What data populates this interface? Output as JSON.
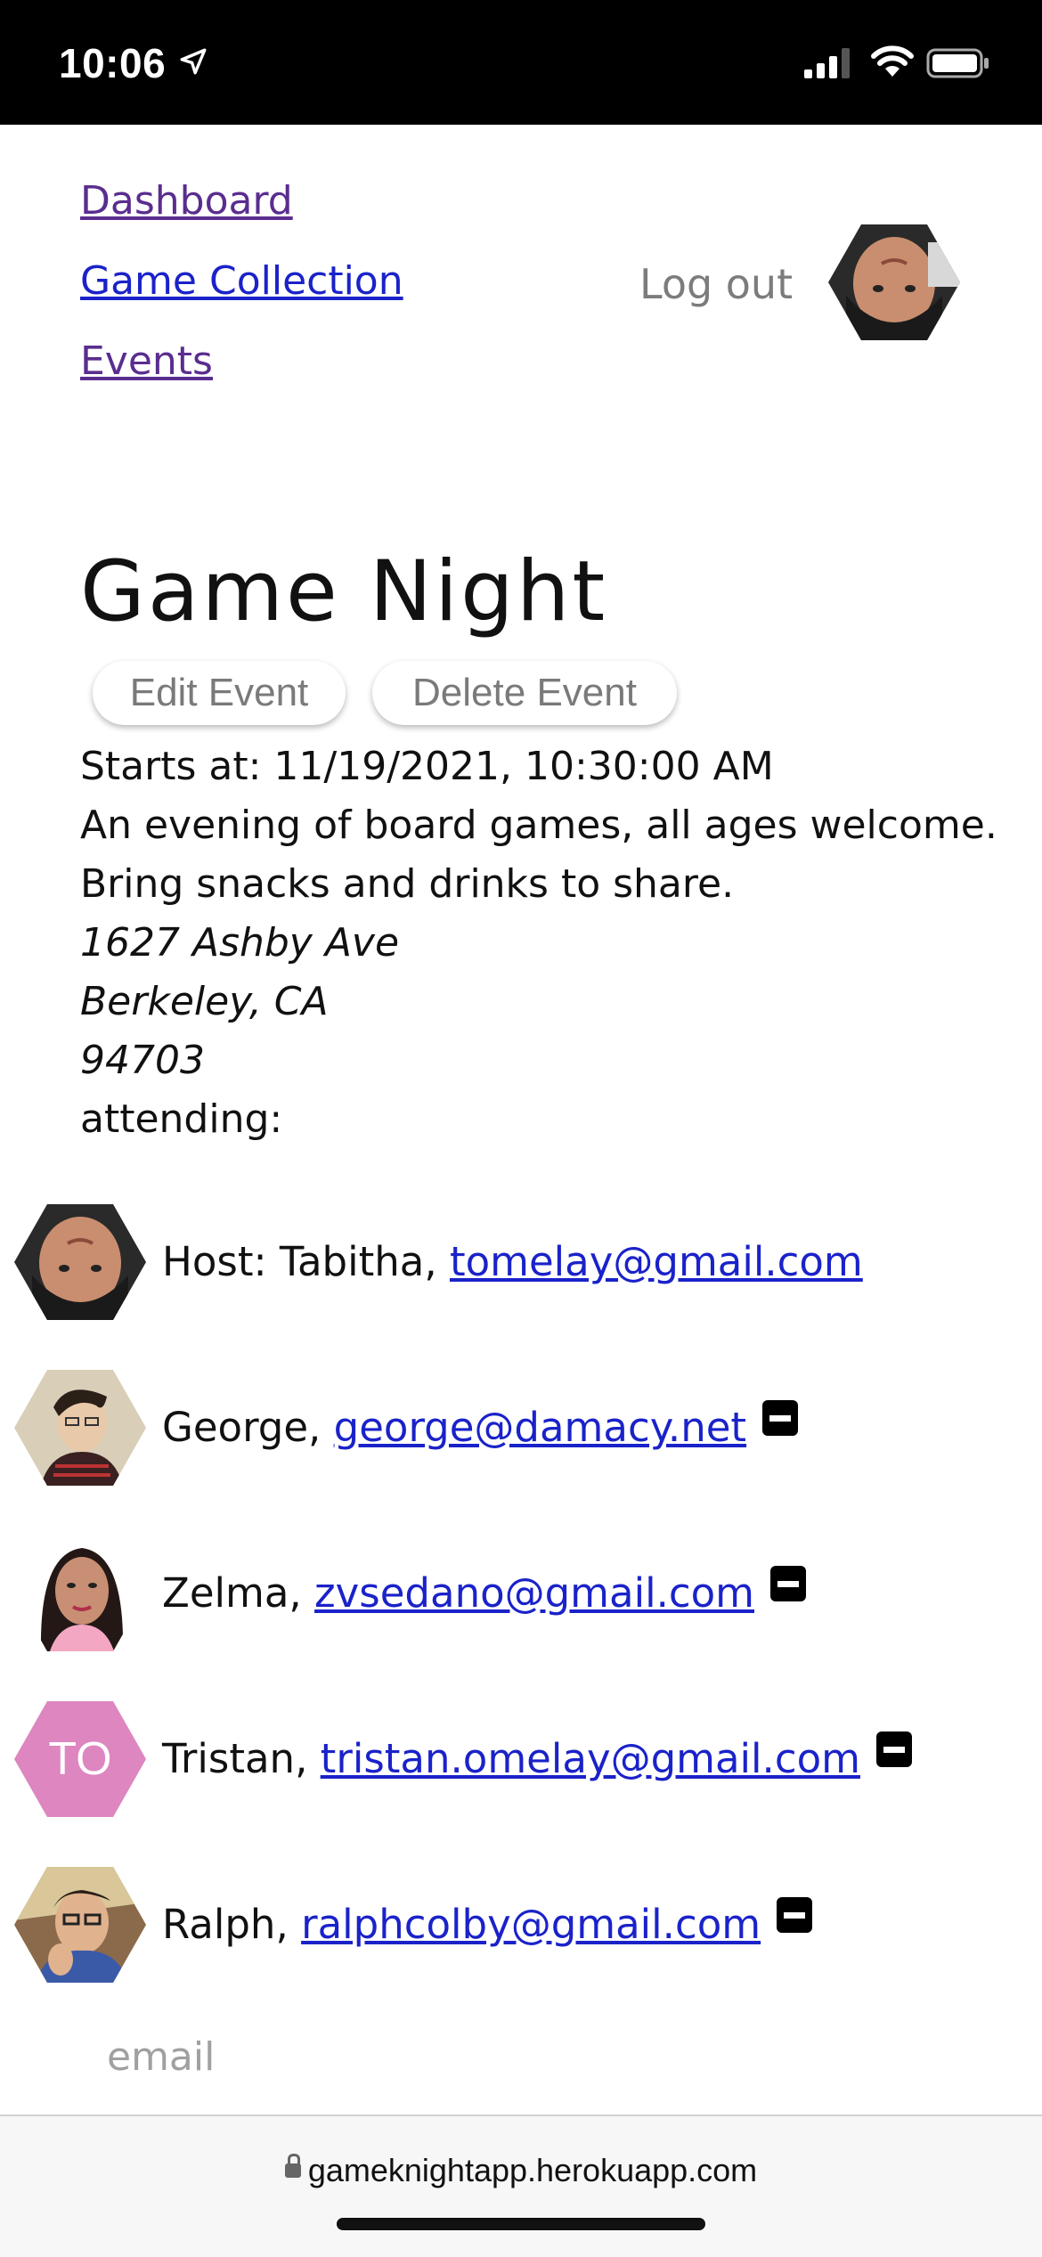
{
  "status_bar": {
    "time": "10:06",
    "icons": [
      "location-arrow-icon",
      "cellular-signal-icon",
      "wifi-icon",
      "battery-icon"
    ]
  },
  "nav": {
    "links": [
      {
        "label": "Dashboard",
        "color": "#5a2d8f"
      },
      {
        "label": "Game Collection",
        "color": "#1a22c9"
      },
      {
        "label": "Events",
        "color": "#5a2d8f"
      }
    ],
    "logout_label": "Log out"
  },
  "event": {
    "title": "Game Night",
    "edit_label": "Edit Event",
    "delete_label": "Delete Event",
    "starts_at": "Starts at: 11/19/2021, 10:30:00 AM",
    "description_line1": "An evening of board games, all ages welcome.",
    "description_line2": "Bring snacks and drinks to share.",
    "address_street": "1627 Ashby Ave",
    "address_city": "Berkeley, CA",
    "address_zip": "94703",
    "attending_label": "attending:"
  },
  "attendees": [
    {
      "prefix": "Host: Tabitha, ",
      "email": "tomelay@gmail.com",
      "removable": false
    },
    {
      "prefix": "George, ",
      "email": "george@damacy.net",
      "removable": true
    },
    {
      "prefix": "Zelma, ",
      "email": "zvsedano@gmail.com",
      "removable": true
    },
    {
      "prefix": "Tristan, ",
      "email": "tristan.omelay@gmail.com",
      "removable": true,
      "initials": "TO",
      "avatar_color": "#dd86c0"
    },
    {
      "prefix": "Ralph, ",
      "email": "ralphcolby@gmail.com",
      "removable": true
    }
  ],
  "invite": {
    "email_placeholder": "email"
  },
  "browser": {
    "url": "gameknightapp.herokuapp.com"
  }
}
